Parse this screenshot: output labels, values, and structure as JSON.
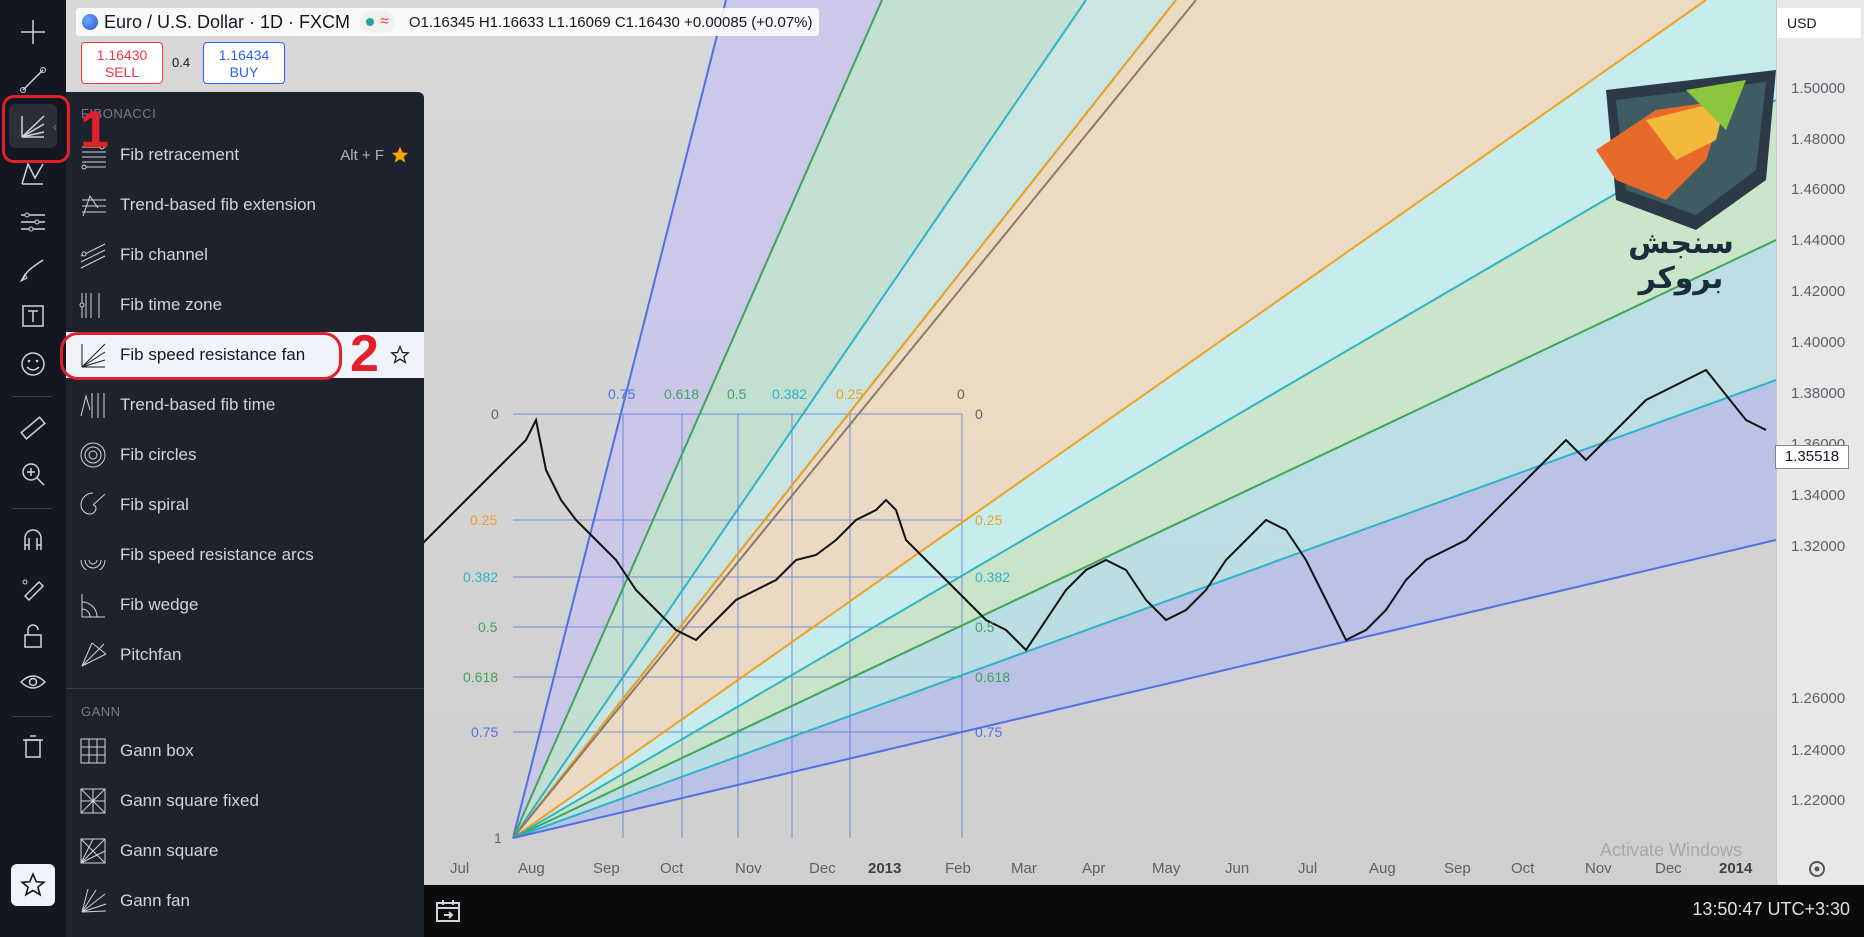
{
  "header": {
    "symbol_title": "Euro / U.S. Dollar · 1D · FXCM",
    "ohlc": "O1.16345 H1.16633 L1.16069 C1.16430 +0.00085 (+0.07%)",
    "sell_price": "1.16430",
    "sell_label": "SELL",
    "buy_price": "1.16434",
    "buy_label": "BUY",
    "spread": "0.4"
  },
  "price_axis": {
    "currency": "USD",
    "labels": [
      "1.50000",
      "1.48000",
      "1.46000",
      "1.44000",
      "1.42000",
      "1.40000",
      "1.38000",
      "1.36000",
      "1.34000",
      "1.32000",
      "1.26000",
      "1.24000",
      "1.22000"
    ],
    "current_price": "1.35518"
  },
  "time_axis": {
    "labels": [
      "Jul",
      "Aug",
      "Sep",
      "Oct",
      "Nov",
      "Dec",
      "2013",
      "Feb",
      "Mar",
      "Apr",
      "May",
      "Jun",
      "Jul",
      "Aug",
      "Sep",
      "Oct",
      "Nov",
      "Dec",
      "2014"
    ]
  },
  "fib_levels": {
    "left_labels": [
      "0",
      "0.25",
      "0.382",
      "0.5",
      "0.618",
      "0.75",
      "1"
    ],
    "right_labels": [
      "0",
      "0.25",
      "0.382",
      "0.5",
      "0.618",
      "0.75"
    ],
    "top_labels": [
      "0.75",
      "0.618",
      "0.5",
      "0.382",
      "0.25",
      "0"
    ]
  },
  "menu": {
    "fibonacci_title": "FIBONACCI",
    "gann_title": "GANN",
    "fib_items": [
      {
        "label": "Fib retracement",
        "shortcut": "Alt + F"
      },
      {
        "label": "Trend-based fib extension"
      },
      {
        "label": "Fib channel"
      },
      {
        "label": "Fib time zone"
      },
      {
        "label": "Fib speed resistance fan"
      },
      {
        "label": "Trend-based fib time"
      },
      {
        "label": "Fib circles"
      },
      {
        "label": "Fib spiral"
      },
      {
        "label": "Fib speed resistance arcs"
      },
      {
        "label": "Fib wedge"
      },
      {
        "label": "Pitchfan"
      }
    ],
    "gann_items": [
      {
        "label": "Gann box"
      },
      {
        "label": "Gann square fixed"
      },
      {
        "label": "Gann square"
      },
      {
        "label": "Gann fan"
      }
    ]
  },
  "annotations": {
    "step1": "1",
    "step2": "2"
  },
  "logo": {
    "text": "سنجش بروکر"
  },
  "bottom_bar": {
    "clock": "13:50:47 UTC+3:30"
  },
  "watermark": "Activate Windows",
  "colors": {
    "toolbar_bg": "#131722",
    "menu_bg": "#1e222d",
    "highlight_bg": "#f0f3fa",
    "annotation_red": "#e3202a",
    "sell_red": "#f23645",
    "buy_blue": "#2962ff"
  }
}
